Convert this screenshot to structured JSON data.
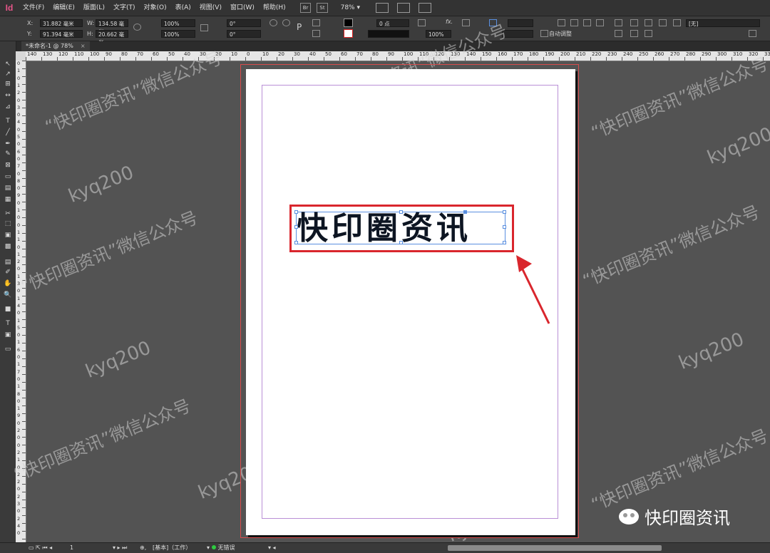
{
  "app": {
    "logo": "Id"
  },
  "menu": [
    "文件(F)",
    "编辑(E)",
    "版面(L)",
    "文字(T)",
    "对象(O)",
    "表(A)",
    "视图(V)",
    "窗口(W)",
    "帮助(H)"
  ],
  "menubar": {
    "br": "Br",
    "st": "St",
    "zoom": "78%"
  },
  "control": {
    "x_label": "X:",
    "x_value": "31.882 毫米",
    "y_label": "Y:",
    "y_value": "91.394 毫米",
    "w_label": "W:",
    "w_value": "134.58 毫米",
    "h_label": "H:",
    "h_value": "20.662 毫米",
    "scale_x": "100%",
    "scale_y": "100%",
    "rotate": "0°",
    "shear": "0°",
    "stroke_weight": "0 点",
    "opacity": "100%",
    "auto_fit": "自动调整",
    "style_value": "[无]"
  },
  "tab": {
    "title": "*未命名-1 @ 78%",
    "close": "×"
  },
  "ruler": {
    "h_ticks": [
      "140",
      "130",
      "120",
      "110",
      "100",
      "90",
      "80",
      "70",
      "60",
      "50",
      "40",
      "30",
      "20",
      "10",
      "0",
      "10",
      "20",
      "30",
      "40",
      "50",
      "60",
      "70",
      "80",
      "90",
      "100",
      "110",
      "120",
      "130",
      "140",
      "150",
      "160",
      "170",
      "180",
      "190",
      "200",
      "210",
      "220",
      "230",
      "240",
      "250",
      "260",
      "270",
      "280",
      "290",
      "300",
      "310",
      "320",
      "33"
    ],
    "v_ticks": [
      "0",
      "1",
      "0",
      "1",
      "2",
      "0",
      "3",
      "0",
      "4",
      "0",
      "5",
      "0",
      "6",
      "0",
      "7",
      "0",
      "8",
      "0",
      "9",
      "0",
      "1",
      "0",
      "0",
      "1",
      "1",
      "0",
      "1",
      "2",
      "0",
      "1",
      "3",
      "0",
      "1",
      "4",
      "0",
      "1",
      "5",
      "0",
      "1",
      "6",
      "0",
      "1",
      "7",
      "0",
      "1",
      "8",
      "0",
      "1",
      "9",
      "0",
      "2",
      "0",
      "0",
      "2",
      "1",
      "0",
      "2",
      "2",
      "0",
      "2",
      "3",
      "0",
      "2",
      "4",
      "0"
    ]
  },
  "tools": [
    "↖",
    "↗",
    "⊞",
    "↔",
    "⊿",
    "T",
    "╱",
    "✒",
    "✎",
    "⊠",
    "▭",
    "▤",
    "▦",
    "✂",
    "⬚",
    "▣",
    "▩",
    "▤",
    "✐",
    "✋",
    "🔍",
    "■",
    "T",
    "▣",
    "▭"
  ],
  "document": {
    "text": "快印圈资讯"
  },
  "watermarks": {
    "phrase": "“快印圈资讯”微信公众号",
    "handle": "kyq200"
  },
  "credit": {
    "text": "快印圈资讯"
  },
  "status": {
    "page": "1",
    "master": "[基本]（工作）",
    "preflight": "无错误"
  },
  "colors": {
    "highlight": "#d9262d",
    "frame": "#5a8fe0",
    "margin": "#b98fd6",
    "bleed": "#d94c4c"
  }
}
